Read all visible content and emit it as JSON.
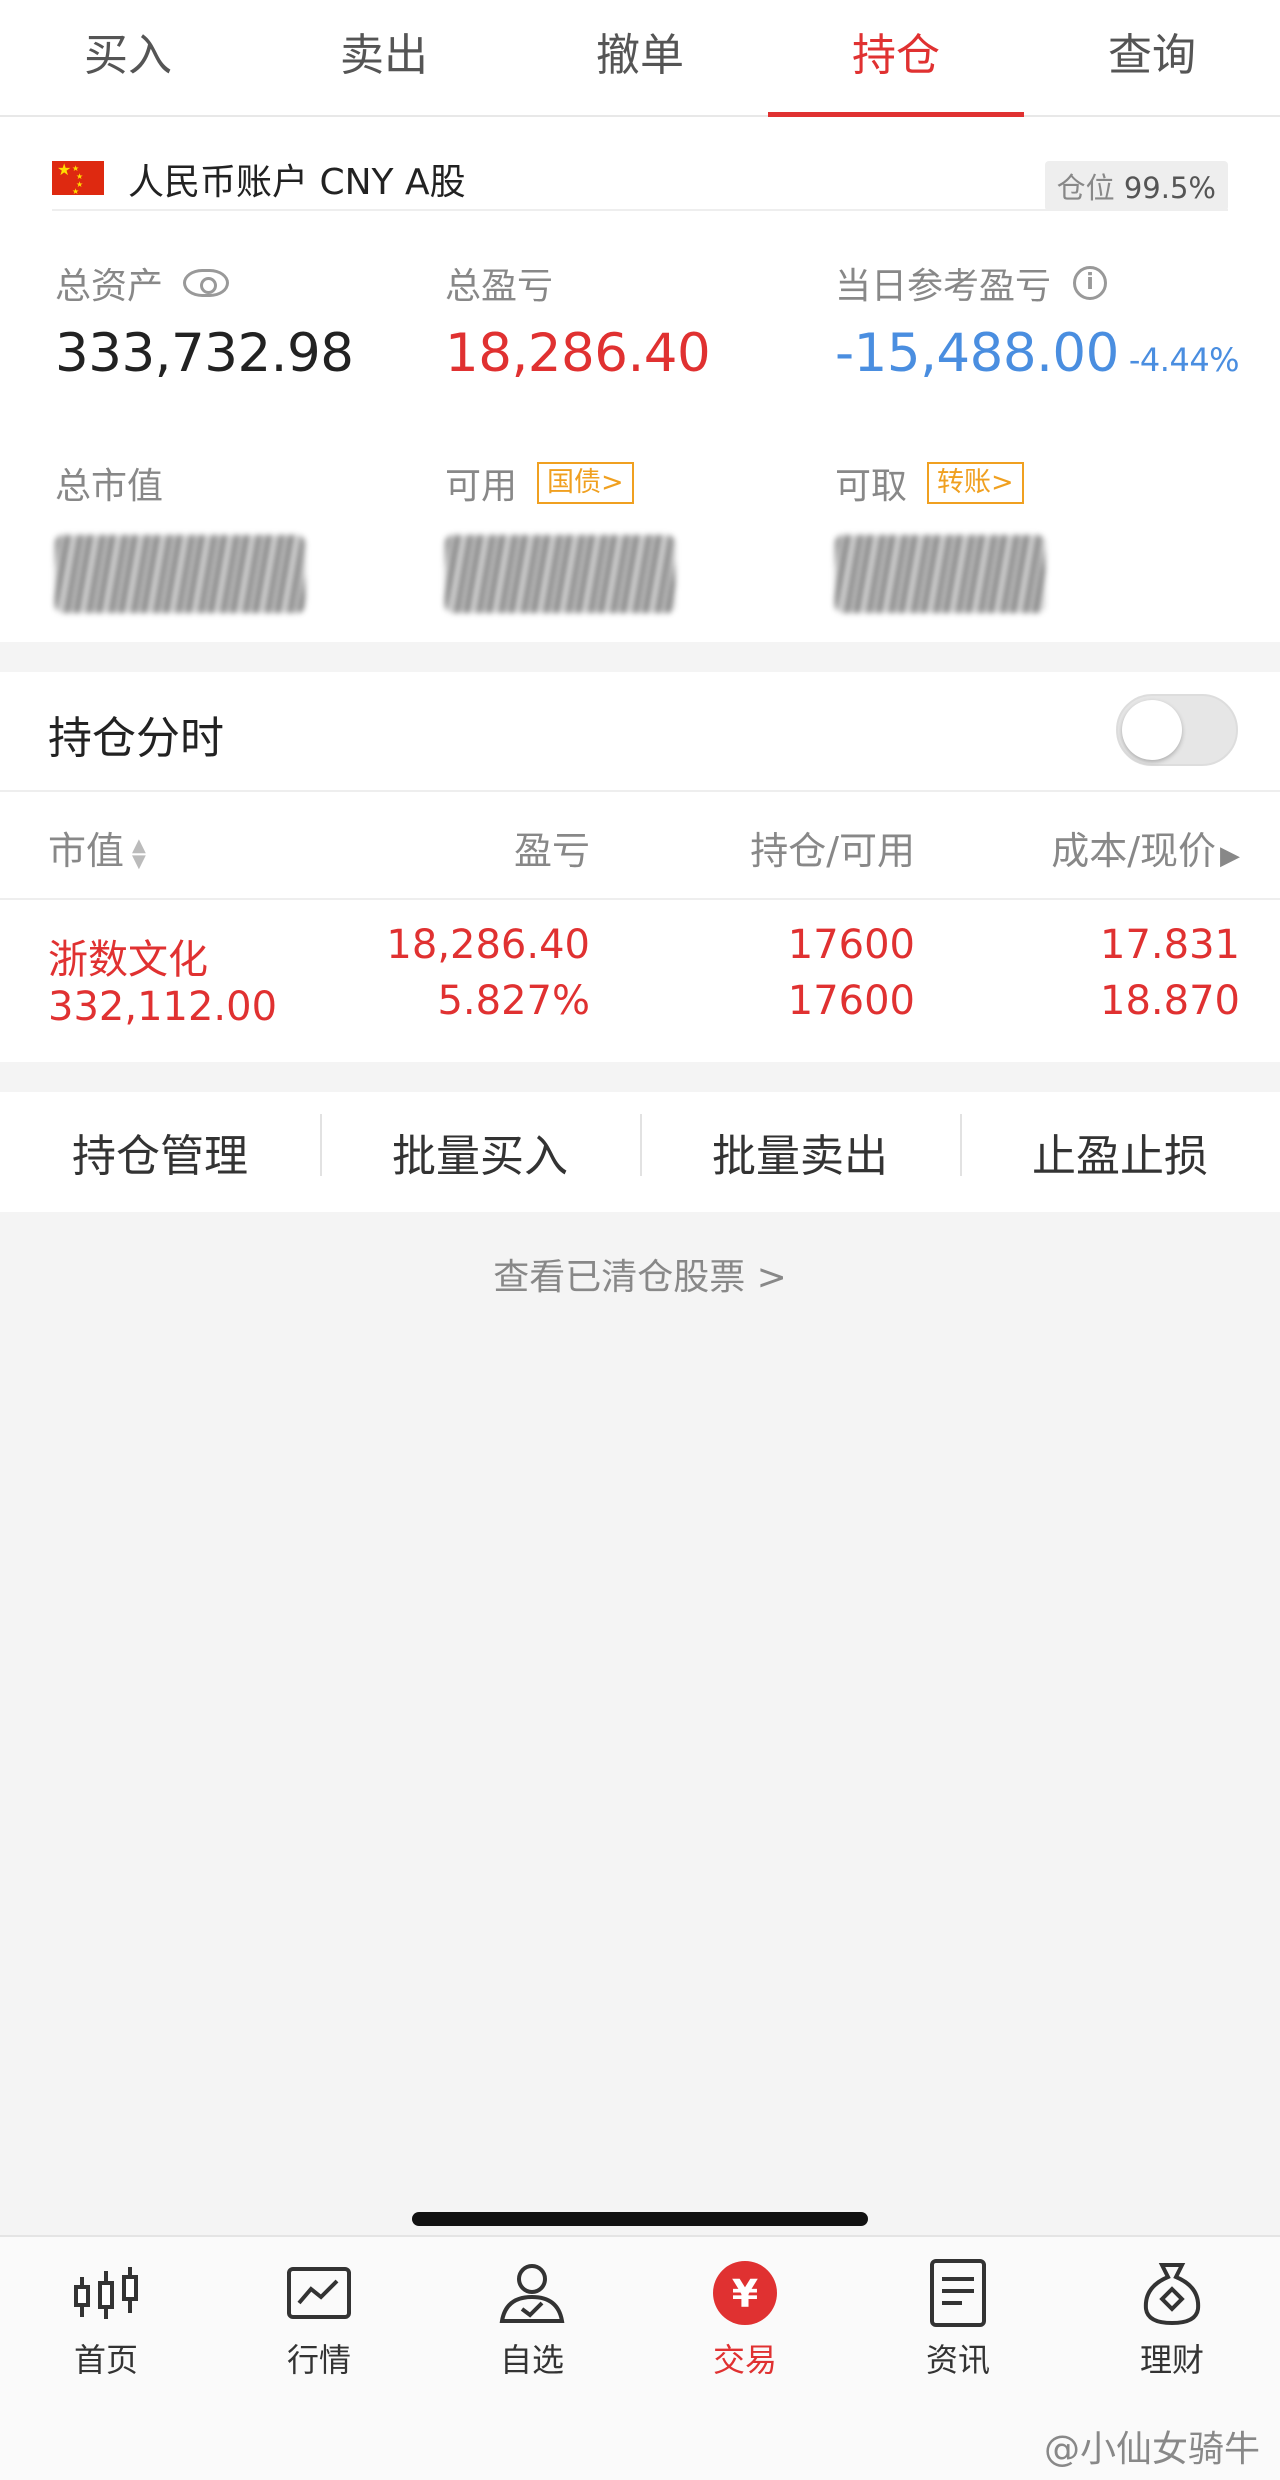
{
  "tabs": [
    {
      "label": "买入"
    },
    {
      "label": "卖出"
    },
    {
      "label": "撤单"
    },
    {
      "label": "持仓"
    },
    {
      "label": "查询"
    }
  ],
  "account": {
    "name": "人民币账户 CNY A股",
    "position_label": "仓位",
    "position_value": "99.5%",
    "total_assets_label": "总资产",
    "total_assets": "333,732.98",
    "total_pnl_label": "总盈亏",
    "total_pnl": "18,286.40",
    "daily_pnl_label": "当日参考盈亏",
    "daily_pnl": "-15,488.00",
    "daily_pnl_pct": "-4.44%",
    "market_value_label": "总市值",
    "available_label": "可用",
    "available_tag": "国债>",
    "withdrawable_label": "可取",
    "withdrawable_tag": "转账>"
  },
  "holdings": {
    "title": "持仓分时",
    "columns": {
      "market_value": "市值",
      "pnl": "盈亏",
      "position": "持仓/可用",
      "cost": "成本/现价"
    },
    "rows": [
      {
        "name": "浙数文化",
        "market_value": "332,112.00",
        "pnl": "18,286.40",
        "pnl_pct": "5.827%",
        "position": "17600",
        "available": "17600",
        "cost": "17.831",
        "price": "18.870"
      }
    ]
  },
  "actions": [
    {
      "label": "持仓管理"
    },
    {
      "label": "批量买入"
    },
    {
      "label": "批量卖出"
    },
    {
      "label": "止盈止损"
    }
  ],
  "cleared_link": "查看已清仓股票 >",
  "nav": [
    {
      "label": "首页",
      "icon": "candlestick-icon"
    },
    {
      "label": "行情",
      "icon": "chart-icon"
    },
    {
      "label": "自选",
      "icon": "user-check-icon"
    },
    {
      "label": "交易",
      "icon": "yuan-icon"
    },
    {
      "label": "资讯",
      "icon": "document-icon"
    },
    {
      "label": "理财",
      "icon": "money-bag-icon"
    }
  ],
  "watermark": "@小仙女骑牛",
  "colors": {
    "accent": "#e03131",
    "down": "#4a8ee0",
    "tag": "#f0a020"
  }
}
